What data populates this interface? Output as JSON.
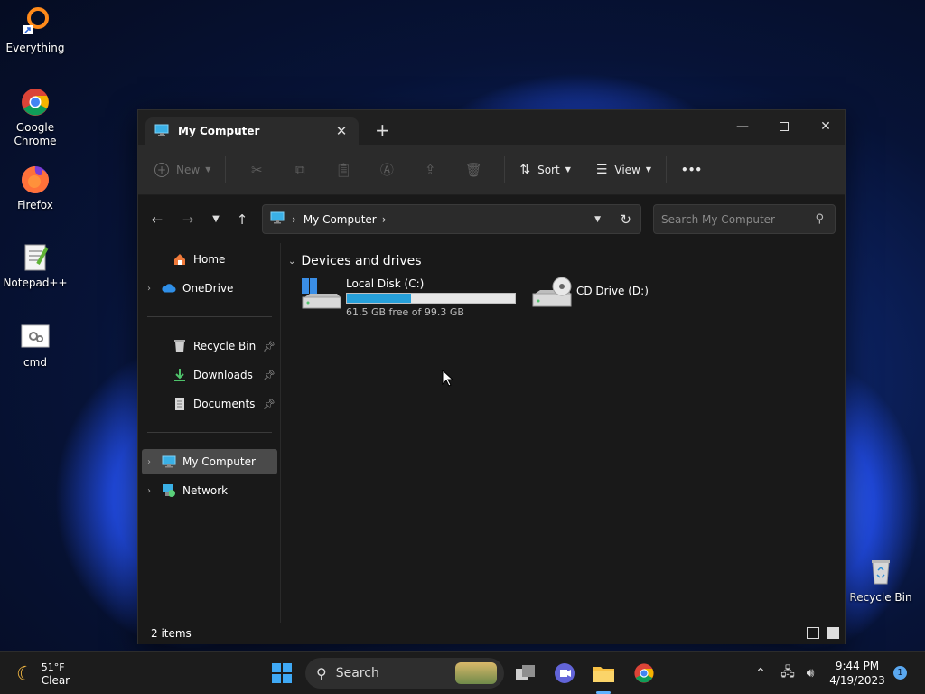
{
  "desktop": {
    "icons": [
      {
        "label": "Everything"
      },
      {
        "label": "Google Chrome"
      },
      {
        "label": "Firefox"
      },
      {
        "label": "Notepad++"
      },
      {
        "label": "cmd"
      },
      {
        "label": "Recycle Bin"
      }
    ]
  },
  "window": {
    "tab_title": "My Computer",
    "toolbar": {
      "new_label": "New",
      "sort_label": "Sort",
      "view_label": "View",
      "more_label": "•••"
    },
    "address": {
      "crumb": "My Computer"
    },
    "search": {
      "placeholder": "Search My Computer"
    },
    "sidebar": {
      "items": [
        {
          "label": "Home"
        },
        {
          "label": "OneDrive"
        },
        {
          "label": "Recycle Bin"
        },
        {
          "label": "Downloads"
        },
        {
          "label": "Documents"
        },
        {
          "label": "My Computer"
        },
        {
          "label": "Network"
        }
      ]
    },
    "content": {
      "group_title": "Devices and drives",
      "drives": [
        {
          "name": "Local Disk (C:)",
          "free_text": "61.5 GB free of 99.3 GB",
          "used_fraction": 0.38
        },
        {
          "name": "CD Drive (D:)"
        }
      ]
    },
    "status": {
      "items_text": "2 items"
    }
  },
  "taskbar": {
    "weather_temp": "51°F",
    "weather_desc": "Clear",
    "search_label": "Search",
    "time": "9:44 PM",
    "date": "4/19/2023",
    "notification_count": "1"
  },
  "colors": {
    "accent": "#26a0da",
    "selected_bg": "#4a4a4a"
  }
}
